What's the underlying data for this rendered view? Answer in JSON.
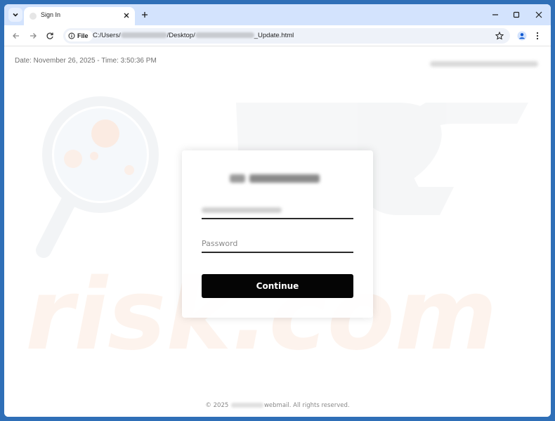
{
  "browser": {
    "tab": {
      "title": "Sign In"
    },
    "address": {
      "chip_label": "File",
      "url_prefix": "C:/Users/",
      "url_mid": "/Desktop/",
      "url_suffix": "_Update.html"
    }
  },
  "page": {
    "datetime": "Date: November 26, 2025 - Time: 3:50:36 PM",
    "password_placeholder": "Password",
    "continue_label": "Continue",
    "footer_prefix": "© 2025",
    "footer_suffix": "webmail. All rights reserved."
  },
  "colors": {
    "titlebar": "#d3e3fd",
    "button": "#050505",
    "desktop": "#2f6fb7"
  },
  "icons": [
    "tab-search-icon",
    "close-icon",
    "plus-icon",
    "minimize-icon",
    "maximize-icon",
    "back-arrow-icon",
    "forward-arrow-icon",
    "reload-icon",
    "info-icon",
    "star-icon",
    "profile-icon",
    "kebab-menu-icon"
  ]
}
